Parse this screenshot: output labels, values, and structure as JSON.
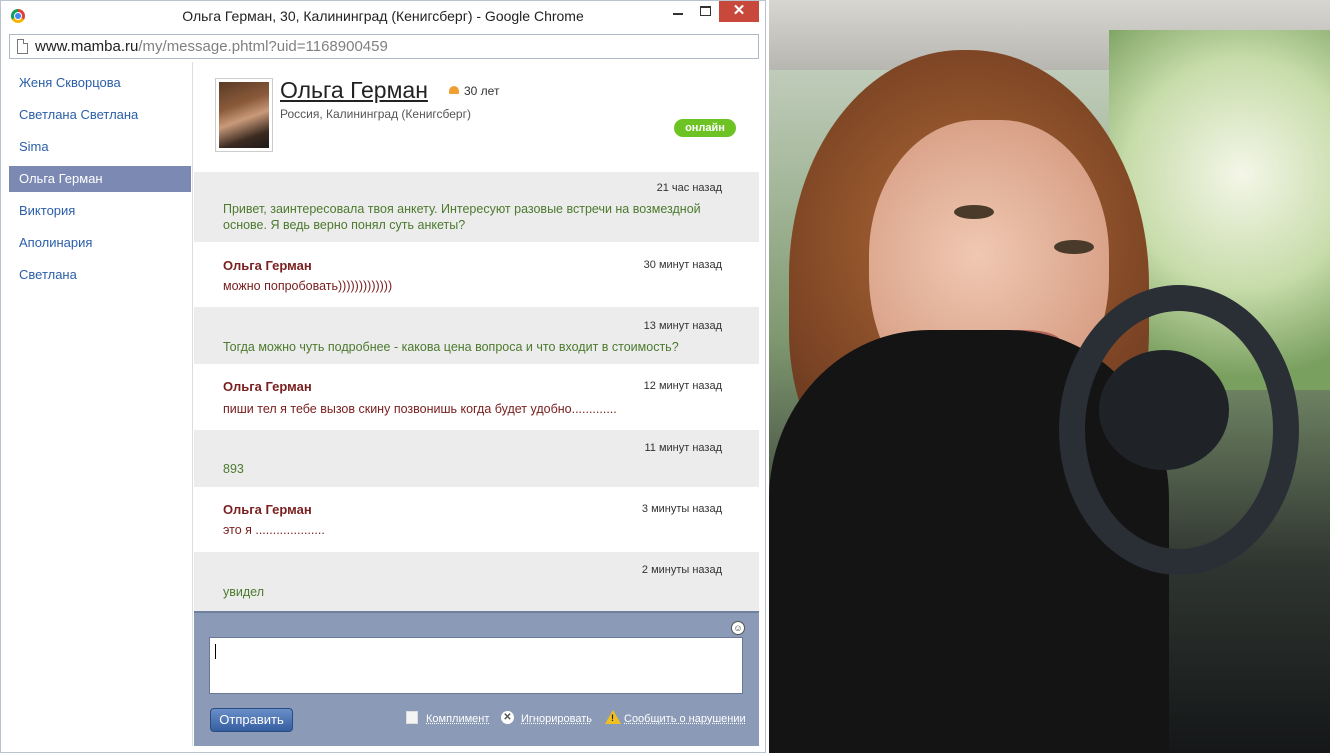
{
  "window": {
    "title": "Ольга Герман, 30, Калининград (Кенигсберг) - Google Chrome",
    "url_domain": "www.mamba.ru",
    "url_path": "/my/message.phtml?uid=1168900459"
  },
  "sidebar": {
    "items": [
      {
        "label": "Женя Скворцова"
      },
      {
        "label": "Светлана Светлана"
      },
      {
        "label": "Sima"
      },
      {
        "label": "Ольга Герман",
        "active": true
      },
      {
        "label": "Виктория"
      },
      {
        "label": "Аполинария"
      },
      {
        "label": "Светлана"
      }
    ]
  },
  "profile": {
    "name": "Ольга Герман",
    "age": "30 лет",
    "location": "Россия, Калининград (Кенигсберг)",
    "status": "онлайн"
  },
  "messages": [
    {
      "time": "21 час назад",
      "text": "Привет, заинтересовала твоя анкету. Интересуют разовые встречи на возмездной основе. Я ведь верно понял суть анкеты?"
    },
    {
      "author": "Ольга Герман",
      "time": "30 минут назад",
      "text": "можно попробовать)))))))))))))"
    },
    {
      "time": "13 минут назад",
      "text": "Тогда можно чуть подробнее - какова цена вопроса и что входит в стоимость?"
    },
    {
      "author": "Ольга Герман",
      "time": "12 минут назад",
      "text": "пиши тел я тебе вызов скину позвонишь когда будет удобно............."
    },
    {
      "time": "11 минут назад",
      "text": "893"
    },
    {
      "author": "Ольга Герман",
      "time": "3 минуты назад",
      "text": "это я ...................."
    },
    {
      "time": "2 минуты назад",
      "text": "увидел"
    }
  ],
  "composer": {
    "send_label": "Отправить",
    "compliment_label": "Комплимент",
    "ignore_label": "Игнорировать",
    "report_label": "Сообщить о нарушении"
  },
  "colors": {
    "sidebar_active": "#7c89b3",
    "online_badge": "#6cc323",
    "composer_bg": "#8b9bb7",
    "close_button": "#c9483c"
  }
}
